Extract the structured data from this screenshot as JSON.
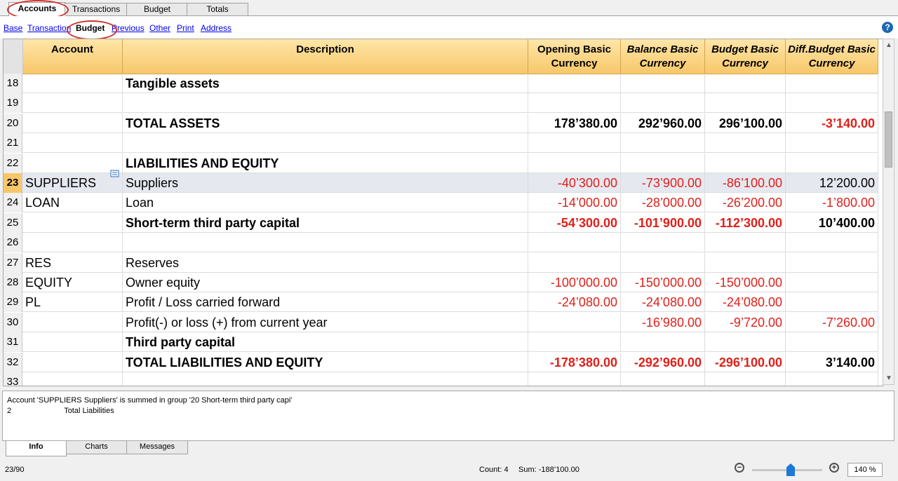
{
  "top_tabs": [
    "Accounts",
    "Transactions",
    "Budget",
    "Totals"
  ],
  "view_links": [
    "Base",
    "Transaction",
    "Budget",
    "Previous",
    "Other",
    "Print",
    "Address"
  ],
  "help_label": "?",
  "columns": {
    "account": "Account",
    "description": "Description",
    "opening": "Opening Basic Currency",
    "balance": "Balance Basic Currency",
    "budget": "Budget Basic Currency",
    "diff": "Diff.Budget Basic Currency"
  },
  "rows": [
    {
      "n": "18",
      "account": "",
      "desc": "Tangible assets",
      "opening": "",
      "balance": "",
      "budget": "",
      "diff": ""
    },
    {
      "n": "19",
      "account": "",
      "desc": "",
      "opening": "",
      "balance": "",
      "budget": "",
      "diff": ""
    },
    {
      "n": "20",
      "account": "",
      "desc": "TOTAL ASSETS",
      "opening": "178’380.00",
      "balance": "292’960.00",
      "budget": "296’100.00",
      "diff": "-3’140.00"
    },
    {
      "n": "21",
      "account": "",
      "desc": "",
      "opening": "",
      "balance": "",
      "budget": "",
      "diff": ""
    },
    {
      "n": "22",
      "account": "",
      "desc": "LIABILITIES AND EQUITY",
      "opening": "",
      "balance": "",
      "budget": "",
      "diff": ""
    },
    {
      "n": "23",
      "account": "SUPPLIERS",
      "desc": "Suppliers",
      "opening": "-40’300.00",
      "balance": "-73’900.00",
      "budget": "-86’100.00",
      "diff": "12’200.00"
    },
    {
      "n": "24",
      "account": "LOAN",
      "desc": "Loan",
      "opening": "-14’000.00",
      "balance": "-28’000.00",
      "budget": "-26’200.00",
      "diff": "-1’800.00"
    },
    {
      "n": "25",
      "account": "",
      "desc": "Short-term third party capital",
      "opening": "-54’300.00",
      "balance": "-101’900.00",
      "budget": "-112’300.00",
      "diff": "10’400.00"
    },
    {
      "n": "26",
      "account": "",
      "desc": "",
      "opening": "",
      "balance": "",
      "budget": "",
      "diff": ""
    },
    {
      "n": "27",
      "account": "RES",
      "desc": "Reserves",
      "opening": "",
      "balance": "",
      "budget": "",
      "diff": ""
    },
    {
      "n": "28",
      "account": "EQUITY",
      "desc": "Owner equity",
      "opening": "-100’000.00",
      "balance": "-150’000.00",
      "budget": "-150’000.00",
      "diff": ""
    },
    {
      "n": "29",
      "account": "PL",
      "desc": "Profit / Loss carried forward",
      "opening": "-24’080.00",
      "balance": "-24’080.00",
      "budget": "-24’080.00",
      "diff": ""
    },
    {
      "n": "30",
      "account": "",
      "desc": "Profit(-) or loss (+) from current year",
      "opening": "",
      "balance": "-16’980.00",
      "budget": "-9’720.00",
      "diff": "-7’260.00"
    },
    {
      "n": "31",
      "account": "",
      "desc": "Third party capital",
      "opening": "",
      "balance": "",
      "budget": "",
      "diff": ""
    },
    {
      "n": "32",
      "account": "",
      "desc": "TOTAL LIABILITIES AND EQUITY",
      "opening": "-178’380.00",
      "balance": "-292’960.00",
      "budget": "-296’100.00",
      "diff": "3’140.00"
    },
    {
      "n": "33",
      "account": "",
      "desc": "",
      "opening": "",
      "balance": "",
      "budget": "",
      "diff": ""
    }
  ],
  "info": {
    "line1": "Account 'SUPPLIERS Suppliers' is summed in group '20 Short-term third party capi'",
    "line2_num": "2",
    "line2_text": "Total Liabilities"
  },
  "bottom_tabs": [
    "Info",
    "Charts",
    "Messages"
  ],
  "status": {
    "position": "23/90",
    "count": "Count: 4",
    "sum": "Sum: -188’100.00",
    "zoom": "140 %"
  },
  "colors": {
    "negative": "#e0201a",
    "header": "#f7c76a",
    "selection": "#e6e8f0",
    "annotation": "#d0302b"
  }
}
